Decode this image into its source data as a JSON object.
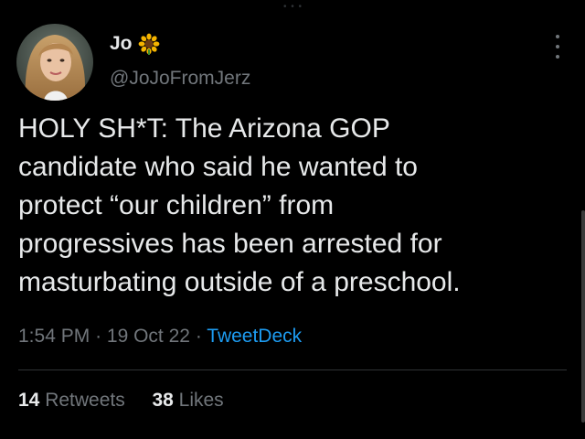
{
  "user": {
    "display_name": "Jo",
    "name_emoji": "sunflower-emoji",
    "handle": "@JoJoFromJerz"
  },
  "tweet": {
    "text": "HOLY SH*T: The Arizona GOP\ncandidate who said he wanted to\nprotect “our children” from\nprogressives has been arrested for\nmasturbating outside of a preschool.",
    "time": "1:54 PM",
    "date": "19 Oct 22",
    "separator": "·",
    "source": "TweetDeck"
  },
  "stats": {
    "retweets_count": "14",
    "retweets_label": "Retweets",
    "likes_count": "38",
    "likes_label": "Likes"
  },
  "colors": {
    "background": "#000000",
    "text": "#e7e9ea",
    "secondary": "#71767b",
    "link": "#1d9bf0",
    "divider": "#2f3336"
  },
  "icons": {
    "more": "more-vertical-icon"
  }
}
